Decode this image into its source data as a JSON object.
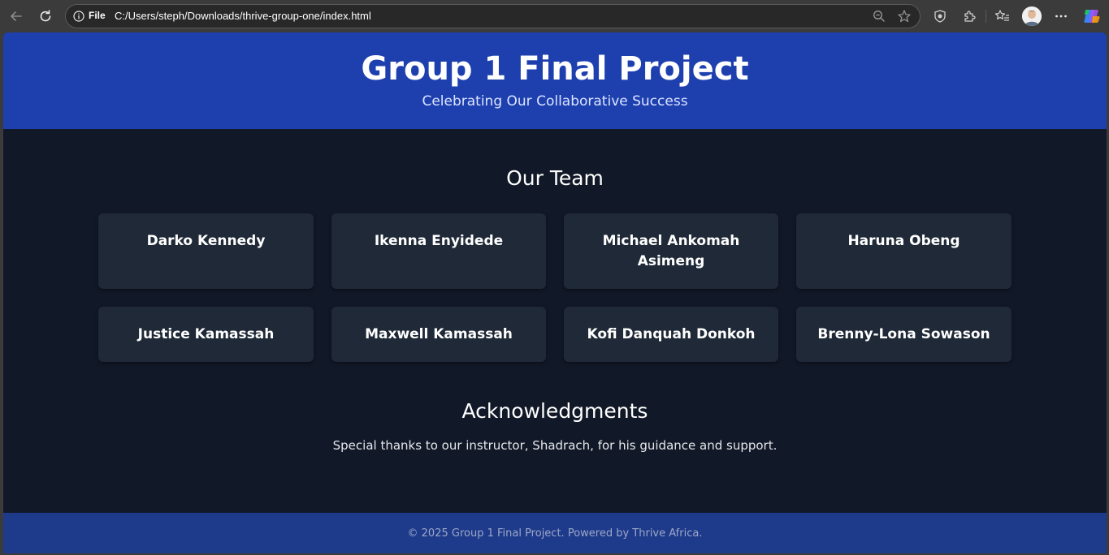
{
  "browser": {
    "file_label": "File",
    "url": "C:/Users/steph/Downloads/thrive-group-one/index.html"
  },
  "header": {
    "title": "Group 1 Final Project",
    "subtitle": "Celebrating Our Collaborative Success"
  },
  "team": {
    "title": "Our Team",
    "members": [
      "Darko Kennedy",
      "Ikenna Enyidede",
      "Michael Ankomah Asimeng",
      "Haruna Obeng",
      "Justice Kamassah",
      "Maxwell Kamassah",
      "Kofi Danquah Donkoh",
      "Brenny-Lona Sowason"
    ]
  },
  "acknowledgments": {
    "title": "Acknowledgments",
    "text": "Special thanks to our instructor, Shadrach, for his guidance and support."
  },
  "footer": {
    "text": "© 2025 Group 1 Final Project. Powered by Thrive Africa."
  },
  "colors": {
    "header_bg": "#1e40af",
    "page_bg": "#111827",
    "card_bg": "#1f2937",
    "footer_bg": "#1e3a8a"
  }
}
